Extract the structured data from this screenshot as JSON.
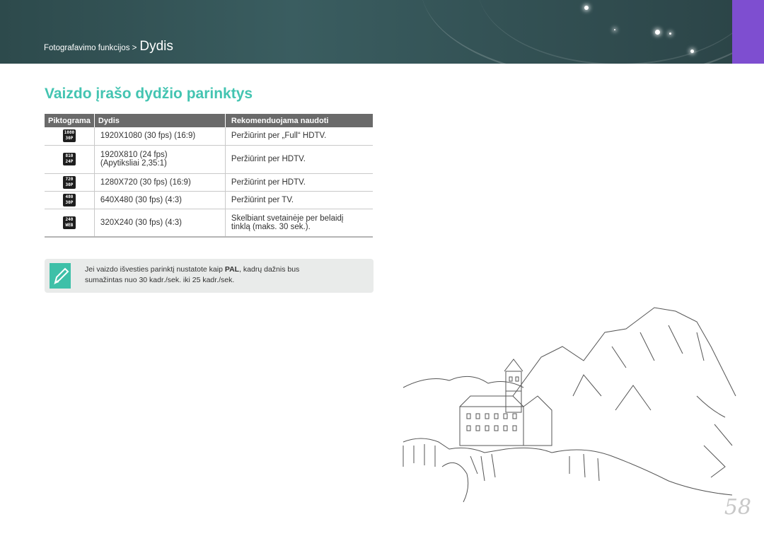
{
  "header": {
    "breadcrumb_parent": "Fotografavimo funkcijos >",
    "breadcrumb_current": "Dydis",
    "accent_color": "#7e4ed0"
  },
  "title": "Vaizdo įrašo dydžio parinktys",
  "table": {
    "headers": [
      "Piktograma",
      "Dydis",
      "Rekomenduojama naudoti"
    ],
    "rows": [
      {
        "icon_top": "1080",
        "icon_bottom": "30P",
        "size": "1920X1080 (30 fps) (16:9)",
        "size2": "",
        "use": "Peržiūrint per „Full“ HDTV.",
        "use2": ""
      },
      {
        "icon_top": "810",
        "icon_bottom": "24P",
        "size": "1920X810 (24 fps)",
        "size2": "(Apytiksliai 2,35:1)",
        "use": "Peržiūrint per HDTV.",
        "use2": ""
      },
      {
        "icon_top": "720",
        "icon_bottom": "30P",
        "size": "1280X720 (30 fps) (16:9)",
        "size2": "",
        "use": "Peržiūrint per HDTV.",
        "use2": ""
      },
      {
        "icon_top": "480",
        "icon_bottom": "30P",
        "size": "640X480 (30 fps) (4:3)",
        "size2": "",
        "use": "Peržiūrint per TV.",
        "use2": ""
      },
      {
        "icon_top": "240",
        "icon_bottom": "WEB",
        "size": "320X240 (30 fps) (4:3)",
        "size2": "",
        "use": "Skelbiant svetainėje per belaidį",
        "use2": "tinklą (maks. 30 sek.)."
      }
    ]
  },
  "note": {
    "line1_a": "Jei vaizdo išvesties parinktį nustatote kaip ",
    "line1_bold": "PAL",
    "line1_b": ", kadrų dažnis bus",
    "line2": "sumažintas nuo 30 kadr./sek. iki 25 kadr./sek."
  },
  "page_number": "58"
}
